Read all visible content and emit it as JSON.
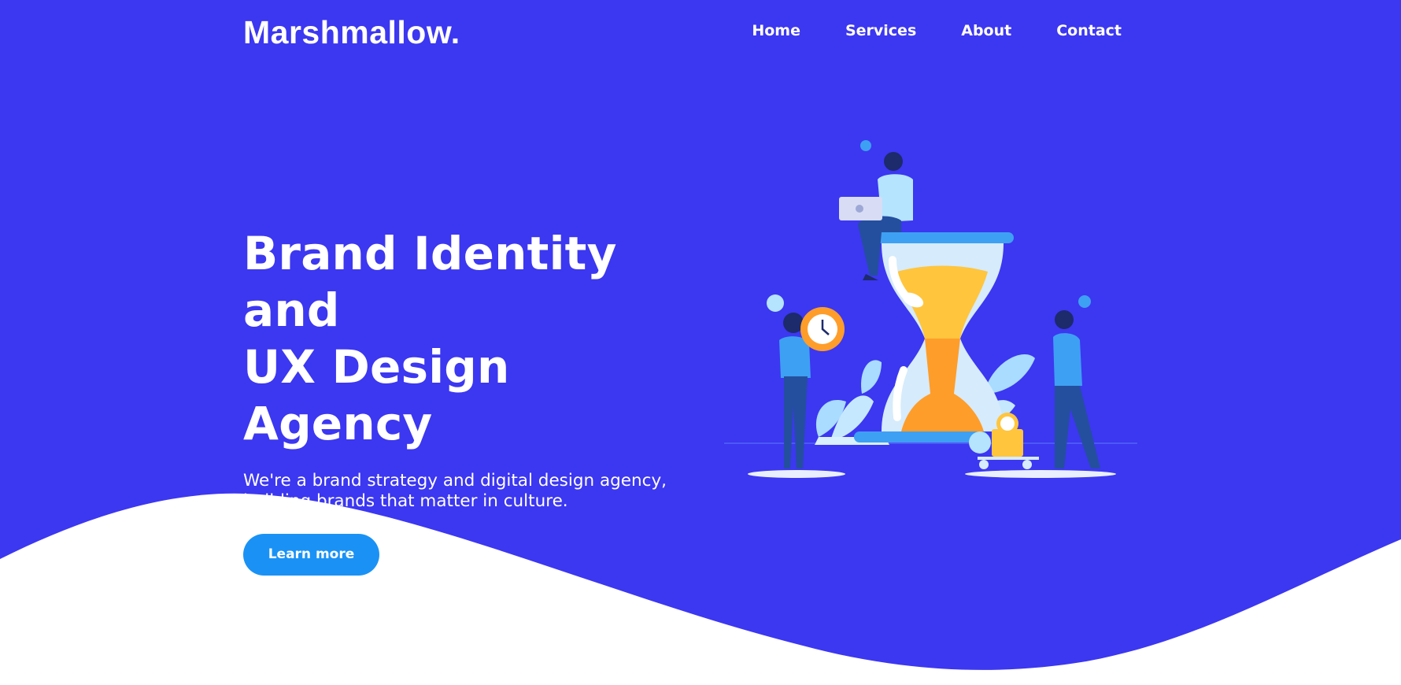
{
  "brand": {
    "logo_text": "Marshmallow."
  },
  "nav": {
    "items": [
      {
        "label": "Home"
      },
      {
        "label": "Services"
      },
      {
        "label": "About"
      },
      {
        "label": "Contact"
      }
    ]
  },
  "hero": {
    "title_line1": "Brand Identity and",
    "title_line2": "UX Design Agency",
    "subtitle_line1": "We're a brand strategy and digital design agency,",
    "subtitle_line2": "building brands that matter in culture.",
    "cta_label": "Learn more"
  },
  "colors": {
    "background": "#3c37f1",
    "cta": "#1a92f5",
    "wave": "#ffffff",
    "sand": "#ffc53d"
  },
  "illustration": {
    "icon": "hourglass-team-illustration"
  }
}
